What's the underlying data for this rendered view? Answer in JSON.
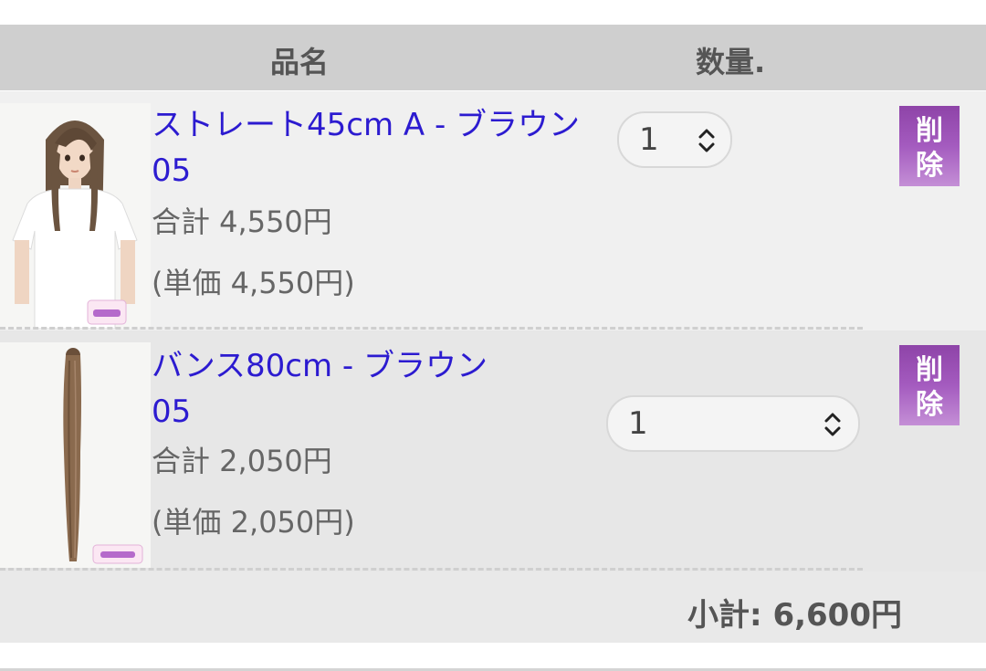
{
  "table_header": {
    "product_name": "品名",
    "quantity": "数量."
  },
  "cart_items": [
    {
      "name": "ストレート45cm A - ブラウン05",
      "line_total": "合計 4,550円",
      "unit_price": "(単価 4,550円)",
      "quantity": "1",
      "delete_label_1": "削",
      "delete_label_2": "除",
      "thumbnail": "wig-long-straight-brown-on-mannequin"
    },
    {
      "name": "バンス80cm - ブラウン05",
      "line_total": "合計 2,050円",
      "unit_price": "(単価 2,050円)",
      "quantity": "1",
      "delete_label_1": "削",
      "delete_label_2": "除",
      "thumbnail": "brown-hair-extension-clip"
    }
  ],
  "subtotal": "小計: 6,600円",
  "colors": {
    "link": "#2c1bd0",
    "delete_button": "#a45bbf",
    "header_bg": "#cfcfcf"
  }
}
